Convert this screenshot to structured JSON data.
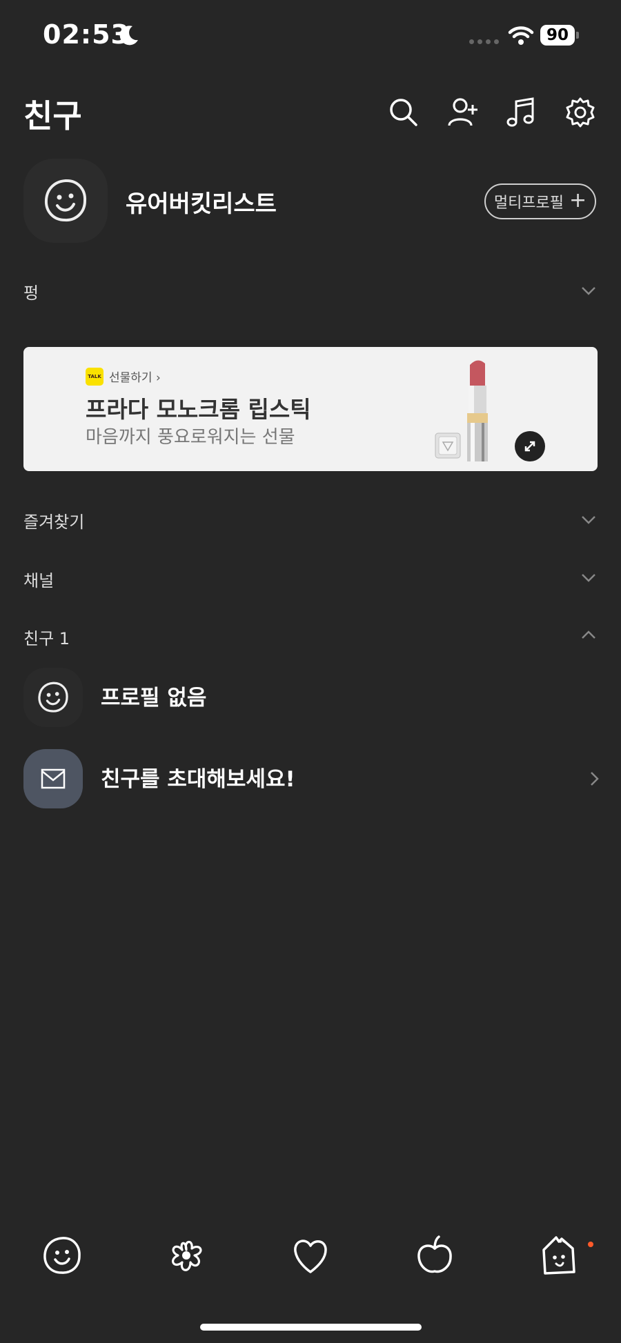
{
  "status_bar": {
    "time": "02:53",
    "battery": "90"
  },
  "header": {
    "title": "친구"
  },
  "profile": {
    "name": "유어버킷리스트",
    "multi_profile_label": "멀티프로필",
    "multi_profile_plus": "+"
  },
  "sections": {
    "birthday": "펑",
    "favorites": "즐겨찾기",
    "channel": "채널",
    "friends": "친구 1"
  },
  "ad": {
    "badge": "TALK",
    "gift_label": "선물하기 ›",
    "title": "프라다 모노크롬 립스틱",
    "subtitle": "마음까지 풍요로워지는 선물"
  },
  "friends": [
    {
      "name": "프로필 없음"
    },
    {
      "name": "친구를 초대해보세요!"
    }
  ],
  "icons": {
    "header": [
      "search-icon",
      "add-friend-icon",
      "music-icon",
      "settings-icon"
    ],
    "tabs": [
      "friends-tab-icon",
      "chats-tab-icon",
      "view-tab-icon",
      "shopping-tab-icon",
      "more-tab-icon"
    ]
  },
  "colors": {
    "background": "#262626",
    "notification": "#ff5a2a",
    "kakao_yellow": "#fae100"
  }
}
